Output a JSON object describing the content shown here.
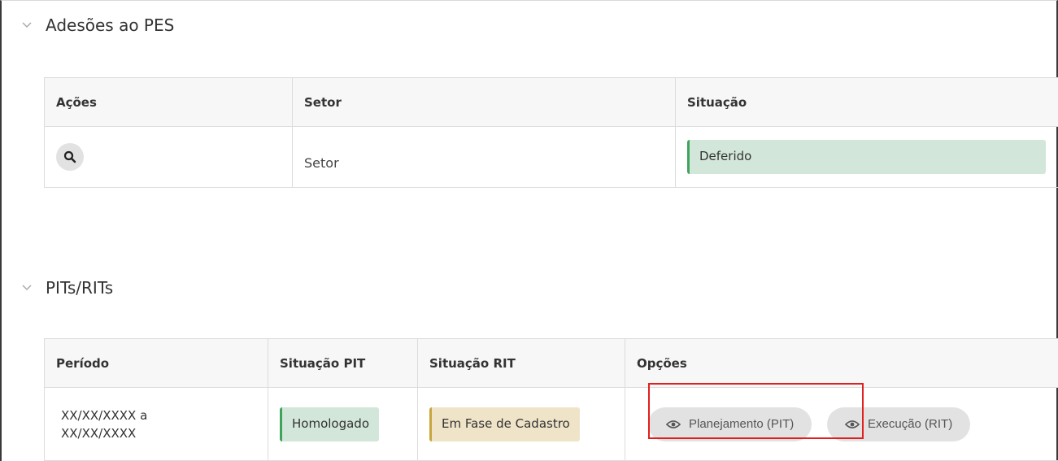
{
  "section_adesoes": {
    "title": "Adesões ao PES",
    "columns": [
      "Ações",
      "Setor",
      "Situação"
    ],
    "row": {
      "setor": "Setor",
      "situacao": "Deferido"
    }
  },
  "section_pits": {
    "title": "PITs/RITs",
    "columns": [
      "Período",
      "Situação PIT",
      "Situação RIT",
      "Opções"
    ],
    "row": {
      "periodo_line1": "XX/XX/XXXX a",
      "periodo_line2": "XX/XX/XXXX",
      "situacao_pit": "Homologado",
      "situacao_rit": "Em Fase de Cadastro",
      "btn_planejamento": "Planejamento (PIT)",
      "btn_execucao": "Execução (RIT)"
    }
  },
  "colors": {
    "status_green": "#3fa45b",
    "status_yellow": "#c9a53e",
    "highlight": "#e01f1f"
  },
  "icons": [
    "chevron-down-icon",
    "search-icon",
    "eye-icon"
  ]
}
